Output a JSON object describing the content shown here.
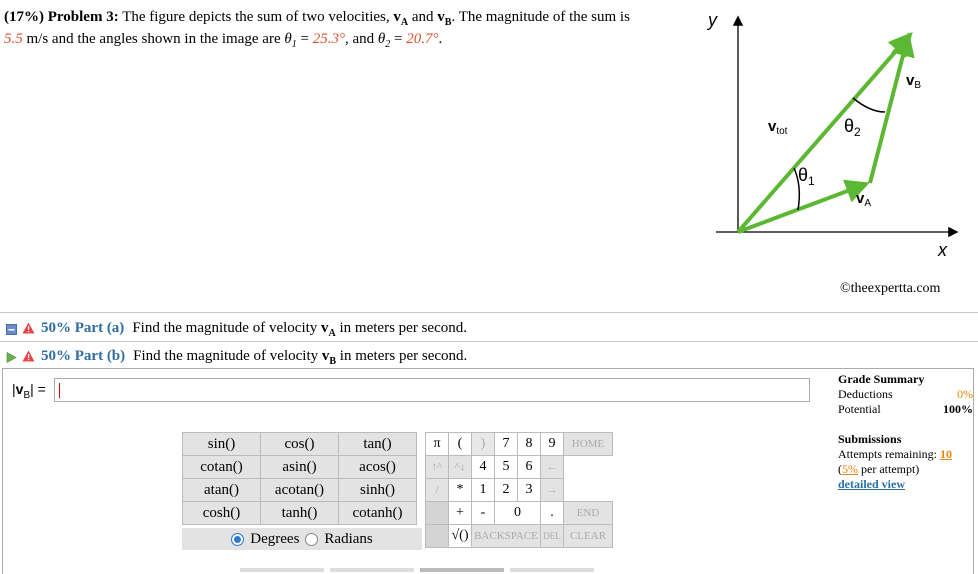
{
  "problem": {
    "pct": "(17%)",
    "name": "Problem 3:",
    "t1": "The figure depicts the sum of two velocities,",
    "va": "v",
    "va_sub": "A",
    "and": "and",
    "vb": "v",
    "vb_sub": "B",
    "t2": ". The magnitude of the sum is",
    "mag": "5.5",
    "t3": "m/s and the angles shown in the image are",
    "th1": "θ",
    "th1_sub": "1",
    "eq1": "=",
    "th1_val": "25.3°",
    "t4": ", and",
    "th2": "θ",
    "th2_sub": "2",
    "eq2": "=",
    "th2_val": "20.7°",
    "t5": "."
  },
  "figure": {
    "y_label": "y",
    "x_label": "x",
    "vtot": "v",
    "vtot_sub": "tot",
    "vb": "v",
    "vb_sub": "B",
    "va": "v",
    "va_sub": "A",
    "theta1": "θ",
    "theta1_sub": "1",
    "theta2": "θ",
    "theta2_sub": "2",
    "color_arrow": "#5cb832"
  },
  "credit": "©theexpertta.com",
  "part_a": {
    "label": "50% Part (a)",
    "text_before": "Find the magnitude of velocity",
    "var": "v",
    "sub": "A",
    "text_after": "in meters per second."
  },
  "part_b": {
    "label": "50% Part (b)",
    "text_before": "Find the magnitude of velocity",
    "var": "v",
    "sub": "B",
    "text_after": "in meters per second."
  },
  "answer": {
    "lhs_bar": "|",
    "lhs_var": "v",
    "lhs_sub": "B",
    "lhs_end": "| =",
    "value": ""
  },
  "grade": {
    "title": "Grade Summary",
    "deductions_label": "Deductions",
    "deductions_value": "0%",
    "potential_label": "Potential",
    "potential_value": "100%",
    "subs_title": "Submissions",
    "attempts_label": "Attempts remaining:",
    "attempts_value": "10",
    "per_open": "(",
    "per_value": "5%",
    "per_text": "per attempt)",
    "detail": "detailed view"
  },
  "functions": [
    [
      "sin()",
      "cos()",
      "tan()"
    ],
    [
      "cotan()",
      "asin()",
      "acos()"
    ],
    [
      "atan()",
      "acotan()",
      "sinh()"
    ],
    [
      "cosh()",
      "tanh()",
      "cotanh()"
    ]
  ],
  "units": {
    "degrees": "Degrees",
    "radians": "Radians",
    "selected": "degrees"
  },
  "keypad": {
    "pi": "π",
    "lparen": "(",
    "rparen": ")",
    "seven": "7",
    "eight": "8",
    "nine": "9",
    "home": "HOME",
    "up": "↑^",
    "down": "^↓",
    "four": "4",
    "five": "5",
    "six": "6",
    "left": "←",
    "slash": "/",
    "star": "*",
    "one": "1",
    "two": "2",
    "three": "3",
    "right": "→",
    "plus": "+",
    "minus": "-",
    "zero": "0",
    "dot": ".",
    "end": "END",
    "sqrt": "√()",
    "backspace": "BACKSPACE",
    "del": "DEL",
    "clear": "CLEAR"
  }
}
